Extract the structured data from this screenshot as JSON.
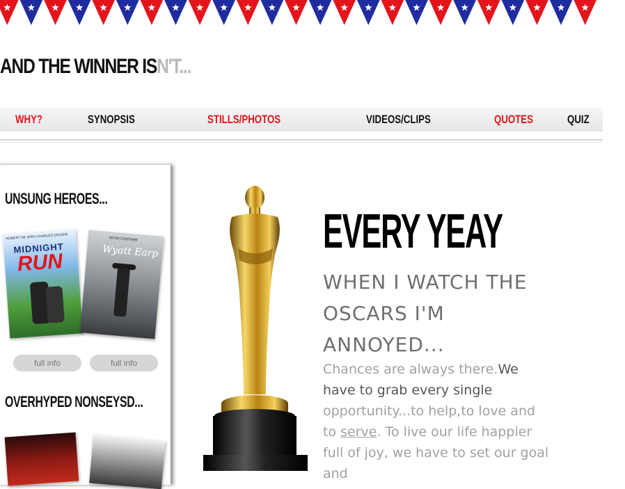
{
  "site": {
    "title_dark": "AND THE WINNER IS",
    "title_light": "N'T..."
  },
  "nav": {
    "items": [
      {
        "label": "WHY?",
        "color": "#e3141b"
      },
      {
        "label": "SYNOPSIS",
        "color": "#111111"
      },
      {
        "label": "STILLS/PHOTOS",
        "color": "#e3141b"
      },
      {
        "label": "VIDEOS/CLIPS",
        "color": "#111111"
      },
      {
        "label": "QUOTES",
        "color": "#e3141b"
      },
      {
        "label": "QUIZ",
        "color": "#111111"
      }
    ]
  },
  "sidebar": {
    "heading1": "UNSUNG HEROES...",
    "heading2": "OVERHYPED NONSEYSD...",
    "posters": [
      {
        "top_credits": "ROBERT DE NIRO   CHARLES GRODIN",
        "title_line1": "MIDNIGHT",
        "title_line2": "RUN"
      },
      {
        "top_credits": "KEVIN COSTNER",
        "title_line1": "Wyatt Earp",
        "title_line2": ""
      }
    ],
    "buttons": [
      "full info",
      "full info"
    ]
  },
  "main": {
    "headline": "EVERY YEAY",
    "subhead": "WHEN I WATCH THE OSCARS I'M ANNOYED...",
    "body_light1": "Chances are always there.",
    "body_strong": "We have to grab every single",
    "body_light2": "opportunity...to help,to love and to",
    "body_link": "serve",
    "body_light3": ". To live our life happier full of joy, we have to set our goal and"
  },
  "colors": {
    "accent_red": "#e3141b",
    "bunting_blue": "#1f2ca0",
    "trophy_gold": "#d4a017"
  }
}
